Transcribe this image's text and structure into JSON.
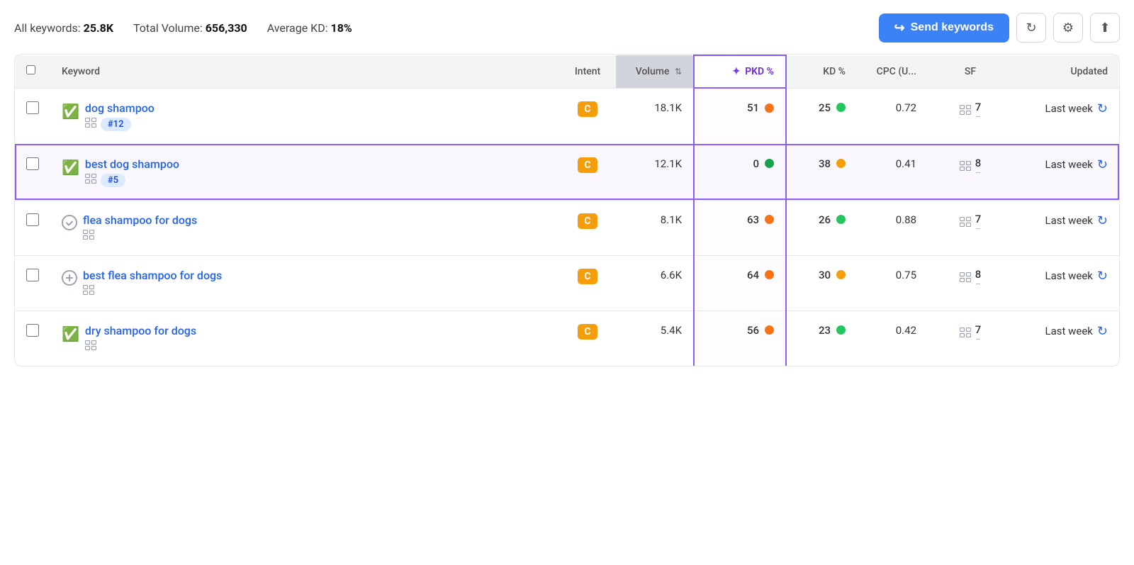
{
  "topBar": {
    "allKeywords": "25.8K",
    "totalVolume": "656,330",
    "averageKD": "18%",
    "allKeywordsLabel": "All keywords:",
    "totalVolumeLabel": "Total Volume:",
    "avgKDLabel": "Average KD:",
    "sendKeywordsLabel": "Send keywords"
  },
  "table": {
    "columns": {
      "keyword": "Keyword",
      "intent": "Intent",
      "volume": "Volume",
      "pkd": "PKD %",
      "kd": "KD %",
      "cpc": "CPC (U...",
      "sf": "SF",
      "updated": "Updated"
    },
    "rows": [
      {
        "id": 1,
        "keyword": "dog shampoo",
        "statusIcon": "check-green",
        "rankBadge": "#12",
        "intent": "C",
        "volume": "18.1K",
        "pkd": "51",
        "pkdDot": "orange",
        "kd": "25",
        "kdDot": "green",
        "cpc": "0.72",
        "sfNum": "7",
        "updated": "Last week",
        "highlighted": false
      },
      {
        "id": 2,
        "keyword": "best dog shampoo",
        "statusIcon": "check-green",
        "rankBadge": "#5",
        "intent": "C",
        "volume": "12.1K",
        "pkd": "0",
        "pkdDot": "dark-green",
        "kd": "38",
        "kdDot": "yellow",
        "cpc": "0.41",
        "sfNum": "8",
        "updated": "Last week",
        "highlighted": true
      },
      {
        "id": 3,
        "keyword": "flea shampoo for dogs",
        "statusIcon": "check-gray",
        "rankBadge": null,
        "intent": "C",
        "volume": "8.1K",
        "pkd": "63",
        "pkdDot": "orange",
        "kd": "26",
        "kdDot": "green",
        "cpc": "0.88",
        "sfNum": "7",
        "updated": "Last week",
        "highlighted": false
      },
      {
        "id": 4,
        "keyword": "best flea shampoo for dogs",
        "statusIcon": "plus-gray",
        "rankBadge": null,
        "intent": "C",
        "volume": "6.6K",
        "pkd": "64",
        "pkdDot": "orange",
        "kd": "30",
        "kdDot": "yellow",
        "cpc": "0.75",
        "sfNum": "8",
        "updated": "Last week",
        "highlighted": false
      },
      {
        "id": 5,
        "keyword": "dry shampoo for dogs",
        "statusIcon": "check-green",
        "rankBadge": null,
        "intent": "C",
        "volume": "5.4K",
        "pkd": "56",
        "pkdDot": "orange",
        "kd": "23",
        "kdDot": "green",
        "cpc": "0.42",
        "sfNum": "7",
        "updated": "Last week",
        "highlighted": false
      }
    ]
  }
}
